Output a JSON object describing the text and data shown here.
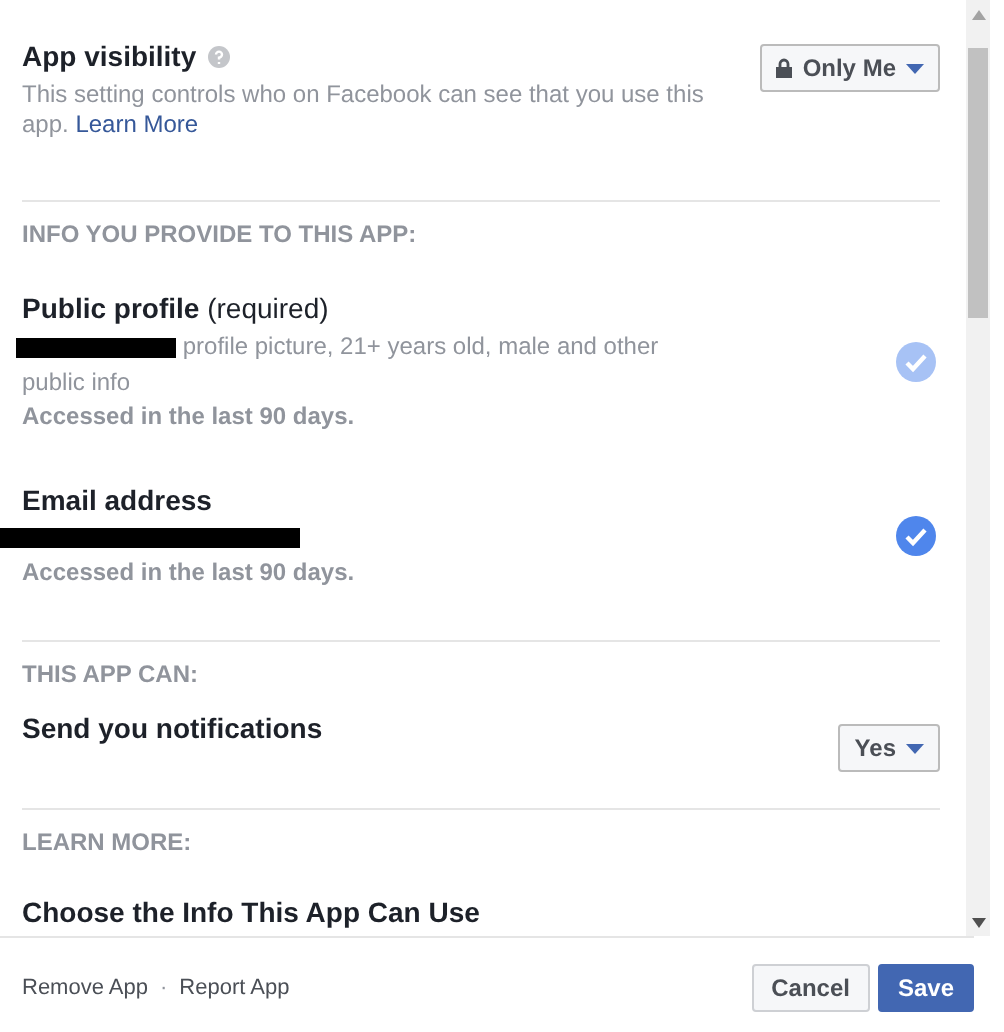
{
  "visibility": {
    "title": "App visibility",
    "description": "This setting controls who on Facebook can see that you use this app.",
    "link": "Learn More",
    "audience": "Only Me"
  },
  "sections": [
    {
      "kind": "info",
      "heading": "INFO YOU PROVIDE TO THIS APP:",
      "items": [
        {
          "title": "Public profile",
          "note": "(required)",
          "detail": "profile picture, 21+ years old, male and other public info",
          "redacted": true,
          "accessed": "Accessed in the last 90 days.",
          "checked": true,
          "disabled": true
        },
        {
          "title": "Email address",
          "redacted": true,
          "accessed": "Accessed in the last 90 days.",
          "checked": true,
          "disabled": false
        }
      ]
    },
    {
      "kind": "permissions",
      "heading": "THIS APP CAN:",
      "items": [
        {
          "title": "Send you notifications",
          "value": "Yes"
        }
      ]
    },
    {
      "kind": "links",
      "heading": "LEARN MORE:",
      "items": [
        {
          "title": "Choose the Info This App Can Use"
        }
      ]
    }
  ],
  "footer": {
    "links": [
      "Remove App",
      "Report App"
    ],
    "separator": "·",
    "buttons": [
      {
        "label": "Cancel",
        "primary": false
      },
      {
        "label": "Save",
        "primary": true
      }
    ]
  }
}
